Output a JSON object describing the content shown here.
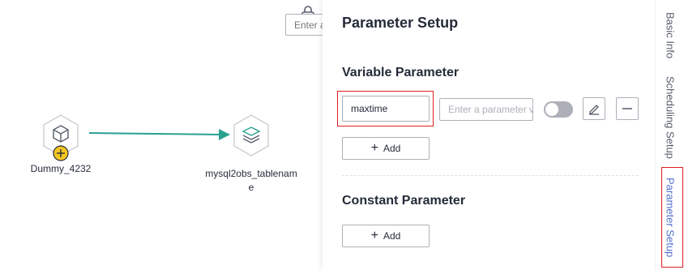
{
  "canvas": {
    "search_placeholder": "Enter a",
    "nodes": [
      {
        "label": "Dummy_4232"
      },
      {
        "label_line1": "mysql2obs_tablenam",
        "label_line2": "e"
      }
    ]
  },
  "panel": {
    "title": "Parameter Setup",
    "variable_section": {
      "title": "Variable Parameter",
      "param_name_value": "maxtime",
      "param_value_placeholder": "Enter a parameter value",
      "add_label": "Add"
    },
    "constant_section": {
      "title": "Constant Parameter",
      "add_label": "Add"
    }
  },
  "vtabs": {
    "items": [
      {
        "label": "Basic Info"
      },
      {
        "label": "Scheduling Setup"
      },
      {
        "label": "Parameter Setup",
        "active": true
      }
    ]
  },
  "colors": {
    "accent": "#526ecc",
    "edge": "#2aa18f",
    "highlight": "#e02020",
    "node_badge": "#f5c623"
  },
  "icons": [
    "lock-icon",
    "cube-icon",
    "add-badge-icon",
    "layers-icon",
    "edit-icon",
    "minus-icon",
    "plus-icon"
  ]
}
